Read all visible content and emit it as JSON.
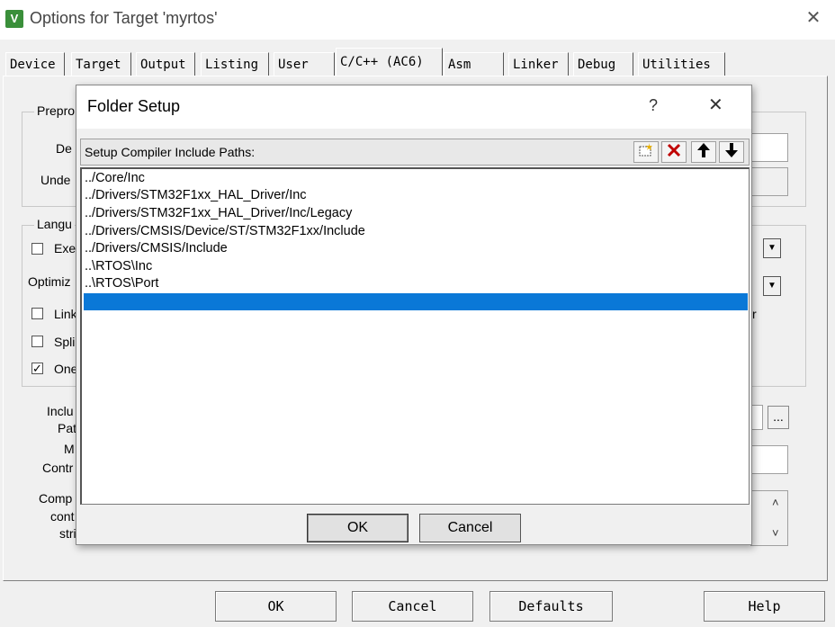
{
  "window": {
    "title": "Options for Target 'myrtos'",
    "app_icon_letter": "V",
    "close_glyph": "✕"
  },
  "tabs": [
    {
      "label": "Device"
    },
    {
      "label": "Target"
    },
    {
      "label": "Output"
    },
    {
      "label": "Listing"
    },
    {
      "label": "User"
    },
    {
      "label": "C/C++ (AC6)",
      "active": true
    },
    {
      "label": "Asm"
    },
    {
      "label": "Linker"
    },
    {
      "label": "Debug"
    },
    {
      "label": "Utilities"
    }
  ],
  "background_form": {
    "preprocessor_group": "Prepro",
    "define_label": "De",
    "undefine_label": "Unde",
    "language_group": "Langu",
    "execute_only_label": "Exe",
    "optimization_label": "Optimiz",
    "link_time_label": "Link",
    "split_label": "Spli",
    "one_elf_label": "One",
    "include_paths_label_1": "Inclu",
    "include_paths_label_2": "Pat",
    "misc_label_1": "M",
    "misc_label_2": "Contr",
    "compiler_label_1": "Comp",
    "compiler_label_2": "cont",
    "compiler_label_3": "stri",
    "browse_button": "...",
    "fragment_r": "r",
    "checkmark": "✓"
  },
  "bottom_buttons": {
    "ok": "OK",
    "cancel": "Cancel",
    "defaults": "Defaults",
    "help": "Help"
  },
  "dialog": {
    "title": "Folder Setup",
    "help_glyph": "?",
    "close_glyph": "✕",
    "list_header": "Setup Compiler Include Paths:",
    "paths": [
      "../Core/Inc",
      "../Drivers/STM32F1xx_HAL_Driver/Inc",
      "../Drivers/STM32F1xx_HAL_Driver/Inc/Legacy",
      "../Drivers/CMSIS/Device/ST/STM32F1xx/Include",
      "../Drivers/CMSIS/Include",
      "..\\RTOS\\Inc",
      "..\\RTOS\\Port"
    ],
    "ok_label": "OK",
    "cancel_label": "Cancel",
    "selection_color": "#0a78d7"
  }
}
